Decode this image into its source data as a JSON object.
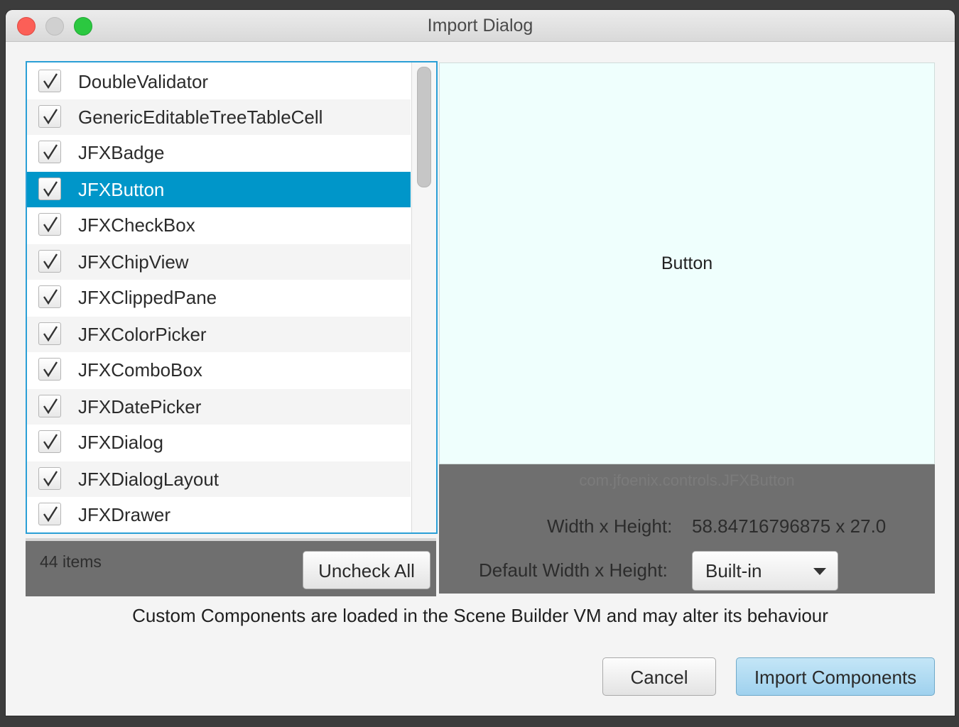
{
  "window": {
    "title": "Import Dialog"
  },
  "list": {
    "selected_index": 3,
    "items": [
      {
        "label": "DoubleValidator",
        "checked": true
      },
      {
        "label": "GenericEditableTreeTableCell",
        "checked": true
      },
      {
        "label": "JFXBadge",
        "checked": true
      },
      {
        "label": "JFXButton",
        "checked": true
      },
      {
        "label": "JFXCheckBox",
        "checked": true
      },
      {
        "label": "JFXChipView",
        "checked": true
      },
      {
        "label": "JFXClippedPane",
        "checked": true
      },
      {
        "label": "JFXColorPicker",
        "checked": true
      },
      {
        "label": "JFXComboBox",
        "checked": true
      },
      {
        "label": "JFXDatePicker",
        "checked": true
      },
      {
        "label": "JFXDialog",
        "checked": true
      },
      {
        "label": "JFXDialogLayout",
        "checked": true
      },
      {
        "label": "JFXDrawer",
        "checked": true
      }
    ],
    "count_text": "44 items",
    "uncheck_all_label": "Uncheck All"
  },
  "preview": {
    "component_label": "Button",
    "class_name": "com.jfoenix.controls.JFXButton",
    "wh_label": "Width x Height:",
    "wh_value": "58.84716796875 x 27.0",
    "default_wh_label": "Default Width x Height:",
    "default_wh_value": "Built-in"
  },
  "footer": {
    "warning": "Custom Components are loaded in the Scene Builder VM and may alter its behaviour",
    "cancel_label": "Cancel",
    "import_label": "Import Components"
  },
  "colors": {
    "selection": "#0096c9",
    "preview_bg": "#effffd",
    "panel_bg": "#6f6f6f",
    "import_button": "#a8d6ef"
  }
}
